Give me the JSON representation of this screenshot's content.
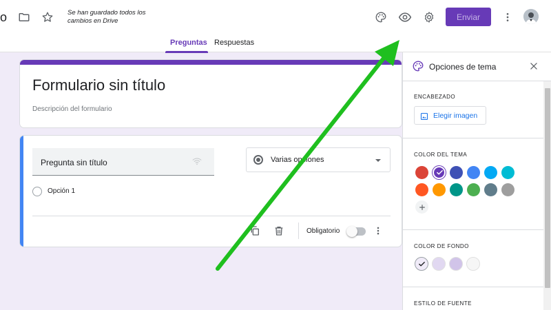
{
  "header": {
    "title_fragment": "o",
    "save_status": "Se han guardado todos los cambios en Drive",
    "send_label": "Enviar",
    "icons": [
      "folder-icon",
      "star-icon",
      "palette-icon",
      "eye-icon",
      "gear-icon",
      "more-vert-icon",
      "avatar"
    ]
  },
  "tabs": [
    {
      "label": "Preguntas",
      "active": true
    },
    {
      "label": "Respuestas",
      "active": false
    }
  ],
  "form": {
    "title": "Formulario sin título",
    "description": "Descripción del formulario"
  },
  "question": {
    "text": "Pregunta sin título",
    "type_label": "Varias opciones",
    "options": [
      {
        "label": "Opción 1"
      }
    ],
    "required_label": "Obligatorio",
    "required": false
  },
  "theme_panel": {
    "title": "Opciones de tema",
    "header_section": {
      "label": "ENCABEZADO",
      "button_label": "Elegir imagen"
    },
    "theme_color_section": {
      "label": "COLOR DEL TEMA",
      "colors": [
        {
          "hex": "#db4437",
          "selected": false
        },
        {
          "hex": "#673ab7",
          "selected": true
        },
        {
          "hex": "#3f51b5",
          "selected": false
        },
        {
          "hex": "#4285f4",
          "selected": false
        },
        {
          "hex": "#03a9f4",
          "selected": false
        },
        {
          "hex": "#00bcd4",
          "selected": false
        },
        {
          "hex": "#ff5722",
          "selected": false
        },
        {
          "hex": "#ff9800",
          "selected": false
        },
        {
          "hex": "#009688",
          "selected": false
        },
        {
          "hex": "#4caf50",
          "selected": false
        },
        {
          "hex": "#607d8b",
          "selected": false
        },
        {
          "hex": "#9e9e9e",
          "selected": false
        }
      ]
    },
    "background_color_section": {
      "label": "COLOR DE FONDO",
      "colors": [
        {
          "hex": "#f0ebf8",
          "selected": true
        },
        {
          "hex": "#e1d8f1",
          "selected": false
        },
        {
          "hex": "#d1c4e9",
          "selected": false
        },
        {
          "hex": "#f6f6f6",
          "selected": false
        }
      ]
    },
    "font_section": {
      "label": "ESTILO DE FUENTE"
    }
  },
  "colors": {
    "accent": "#673ab7",
    "question_accent": "#4285f4",
    "page_background": "#f0ebf8",
    "annotation_arrow": "#1fbf1f"
  }
}
